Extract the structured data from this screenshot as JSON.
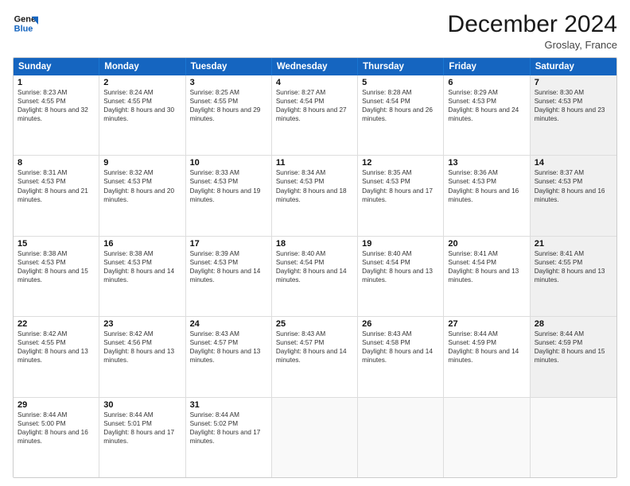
{
  "logo": {
    "line1": "General",
    "line2": "Blue"
  },
  "title": "December 2024",
  "location": "Groslay, France",
  "header_days": [
    "Sunday",
    "Monday",
    "Tuesday",
    "Wednesday",
    "Thursday",
    "Friday",
    "Saturday"
  ],
  "weeks": [
    [
      {
        "day": "1",
        "sunrise": "Sunrise: 8:23 AM",
        "sunset": "Sunset: 4:55 PM",
        "daylight": "Daylight: 8 hours and 32 minutes.",
        "shaded": false
      },
      {
        "day": "2",
        "sunrise": "Sunrise: 8:24 AM",
        "sunset": "Sunset: 4:55 PM",
        "daylight": "Daylight: 8 hours and 30 minutes.",
        "shaded": false
      },
      {
        "day": "3",
        "sunrise": "Sunrise: 8:25 AM",
        "sunset": "Sunset: 4:55 PM",
        "daylight": "Daylight: 8 hours and 29 minutes.",
        "shaded": false
      },
      {
        "day": "4",
        "sunrise": "Sunrise: 8:27 AM",
        "sunset": "Sunset: 4:54 PM",
        "daylight": "Daylight: 8 hours and 27 minutes.",
        "shaded": false
      },
      {
        "day": "5",
        "sunrise": "Sunrise: 8:28 AM",
        "sunset": "Sunset: 4:54 PM",
        "daylight": "Daylight: 8 hours and 26 minutes.",
        "shaded": false
      },
      {
        "day": "6",
        "sunrise": "Sunrise: 8:29 AM",
        "sunset": "Sunset: 4:53 PM",
        "daylight": "Daylight: 8 hours and 24 minutes.",
        "shaded": false
      },
      {
        "day": "7",
        "sunrise": "Sunrise: 8:30 AM",
        "sunset": "Sunset: 4:53 PM",
        "daylight": "Daylight: 8 hours and 23 minutes.",
        "shaded": true
      }
    ],
    [
      {
        "day": "8",
        "sunrise": "Sunrise: 8:31 AM",
        "sunset": "Sunset: 4:53 PM",
        "daylight": "Daylight: 8 hours and 21 minutes.",
        "shaded": false
      },
      {
        "day": "9",
        "sunrise": "Sunrise: 8:32 AM",
        "sunset": "Sunset: 4:53 PM",
        "daylight": "Daylight: 8 hours and 20 minutes.",
        "shaded": false
      },
      {
        "day": "10",
        "sunrise": "Sunrise: 8:33 AM",
        "sunset": "Sunset: 4:53 PM",
        "daylight": "Daylight: 8 hours and 19 minutes.",
        "shaded": false
      },
      {
        "day": "11",
        "sunrise": "Sunrise: 8:34 AM",
        "sunset": "Sunset: 4:53 PM",
        "daylight": "Daylight: 8 hours and 18 minutes.",
        "shaded": false
      },
      {
        "day": "12",
        "sunrise": "Sunrise: 8:35 AM",
        "sunset": "Sunset: 4:53 PM",
        "daylight": "Daylight: 8 hours and 17 minutes.",
        "shaded": false
      },
      {
        "day": "13",
        "sunrise": "Sunrise: 8:36 AM",
        "sunset": "Sunset: 4:53 PM",
        "daylight": "Daylight: 8 hours and 16 minutes.",
        "shaded": false
      },
      {
        "day": "14",
        "sunrise": "Sunrise: 8:37 AM",
        "sunset": "Sunset: 4:53 PM",
        "daylight": "Daylight: 8 hours and 16 minutes.",
        "shaded": true
      }
    ],
    [
      {
        "day": "15",
        "sunrise": "Sunrise: 8:38 AM",
        "sunset": "Sunset: 4:53 PM",
        "daylight": "Daylight: 8 hours and 15 minutes.",
        "shaded": false
      },
      {
        "day": "16",
        "sunrise": "Sunrise: 8:38 AM",
        "sunset": "Sunset: 4:53 PM",
        "daylight": "Daylight: 8 hours and 14 minutes.",
        "shaded": false
      },
      {
        "day": "17",
        "sunrise": "Sunrise: 8:39 AM",
        "sunset": "Sunset: 4:53 PM",
        "daylight": "Daylight: 8 hours and 14 minutes.",
        "shaded": false
      },
      {
        "day": "18",
        "sunrise": "Sunrise: 8:40 AM",
        "sunset": "Sunset: 4:54 PM",
        "daylight": "Daylight: 8 hours and 14 minutes.",
        "shaded": false
      },
      {
        "day": "19",
        "sunrise": "Sunrise: 8:40 AM",
        "sunset": "Sunset: 4:54 PM",
        "daylight": "Daylight: 8 hours and 13 minutes.",
        "shaded": false
      },
      {
        "day": "20",
        "sunrise": "Sunrise: 8:41 AM",
        "sunset": "Sunset: 4:54 PM",
        "daylight": "Daylight: 8 hours and 13 minutes.",
        "shaded": false
      },
      {
        "day": "21",
        "sunrise": "Sunrise: 8:41 AM",
        "sunset": "Sunset: 4:55 PM",
        "daylight": "Daylight: 8 hours and 13 minutes.",
        "shaded": true
      }
    ],
    [
      {
        "day": "22",
        "sunrise": "Sunrise: 8:42 AM",
        "sunset": "Sunset: 4:55 PM",
        "daylight": "Daylight: 8 hours and 13 minutes.",
        "shaded": false
      },
      {
        "day": "23",
        "sunrise": "Sunrise: 8:42 AM",
        "sunset": "Sunset: 4:56 PM",
        "daylight": "Daylight: 8 hours and 13 minutes.",
        "shaded": false
      },
      {
        "day": "24",
        "sunrise": "Sunrise: 8:43 AM",
        "sunset": "Sunset: 4:57 PM",
        "daylight": "Daylight: 8 hours and 13 minutes.",
        "shaded": false
      },
      {
        "day": "25",
        "sunrise": "Sunrise: 8:43 AM",
        "sunset": "Sunset: 4:57 PM",
        "daylight": "Daylight: 8 hours and 14 minutes.",
        "shaded": false
      },
      {
        "day": "26",
        "sunrise": "Sunrise: 8:43 AM",
        "sunset": "Sunset: 4:58 PM",
        "daylight": "Daylight: 8 hours and 14 minutes.",
        "shaded": false
      },
      {
        "day": "27",
        "sunrise": "Sunrise: 8:44 AM",
        "sunset": "Sunset: 4:59 PM",
        "daylight": "Daylight: 8 hours and 14 minutes.",
        "shaded": false
      },
      {
        "day": "28",
        "sunrise": "Sunrise: 8:44 AM",
        "sunset": "Sunset: 4:59 PM",
        "daylight": "Daylight: 8 hours and 15 minutes.",
        "shaded": true
      }
    ],
    [
      {
        "day": "29",
        "sunrise": "Sunrise: 8:44 AM",
        "sunset": "Sunset: 5:00 PM",
        "daylight": "Daylight: 8 hours and 16 minutes.",
        "shaded": false
      },
      {
        "day": "30",
        "sunrise": "Sunrise: 8:44 AM",
        "sunset": "Sunset: 5:01 PM",
        "daylight": "Daylight: 8 hours and 17 minutes.",
        "shaded": false
      },
      {
        "day": "31",
        "sunrise": "Sunrise: 8:44 AM",
        "sunset": "Sunset: 5:02 PM",
        "daylight": "Daylight: 8 hours and 17 minutes.",
        "shaded": false
      },
      {
        "day": "",
        "sunrise": "",
        "sunset": "",
        "daylight": "",
        "shaded": false,
        "empty": true
      },
      {
        "day": "",
        "sunrise": "",
        "sunset": "",
        "daylight": "",
        "shaded": false,
        "empty": true
      },
      {
        "day": "",
        "sunrise": "",
        "sunset": "",
        "daylight": "",
        "shaded": false,
        "empty": true
      },
      {
        "day": "",
        "sunrise": "",
        "sunset": "",
        "daylight": "",
        "shaded": true,
        "empty": true
      }
    ]
  ]
}
